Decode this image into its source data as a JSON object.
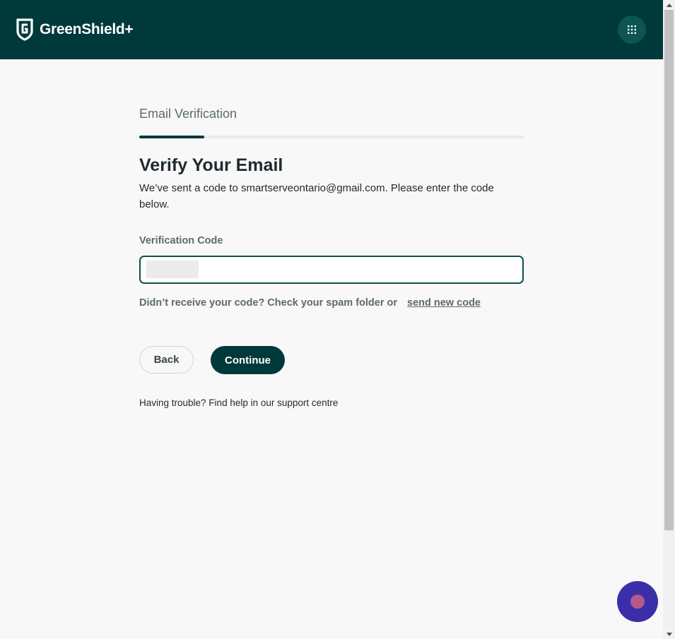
{
  "header": {
    "brand_name": "GreenShield+",
    "logo_icon": "shield-logo-icon",
    "apps_icon": "grid-icon"
  },
  "step": {
    "title": "Email Verification",
    "progress_fraction": 0.17
  },
  "main": {
    "heading": "Verify Your Email",
    "description": "We’ve sent a code to smartserveontario@gmail.com. Please enter the code below.",
    "field_label": "Verification Code",
    "code_value": "",
    "resend_text": "Didn’t receive your code? Check your spam folder or",
    "resend_link": "send new code",
    "back_label": "Back",
    "continue_label": "Continue",
    "help_text": "Having trouble? Find help in our support centre"
  },
  "colors": {
    "brand_dark": "#00393a",
    "chat_button": "#3a2fa8",
    "chat_dot": "#b45b8a"
  }
}
